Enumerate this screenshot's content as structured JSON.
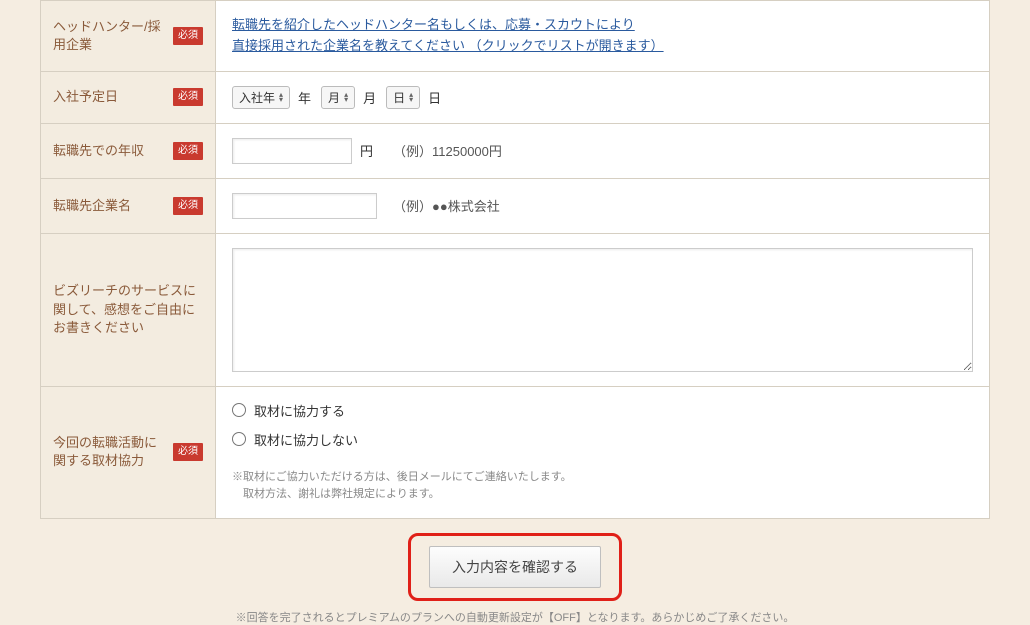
{
  "required_label": "必須",
  "rows": {
    "headhunter": {
      "label": "ヘッドハンター/採用企業",
      "required": true,
      "link_line1": "転職先を紹介したヘッドハンター名もしくは、応募・スカウトにより",
      "link_line2": "直接採用された企業名を教えてください （クリックでリストが開きます）"
    },
    "start_date": {
      "label": "入社予定日",
      "required": true,
      "year_select": "入社年",
      "month_select": "月",
      "day_select": "日",
      "year_unit": "年",
      "month_unit": "月",
      "day_unit": "日"
    },
    "salary": {
      "label": "転職先での年収",
      "required": true,
      "unit": "円",
      "example": "（例）11250000円"
    },
    "company": {
      "label": "転職先企業名",
      "required": true,
      "example": "（例）●●株式会社"
    },
    "feedback": {
      "label": "ビズリーチのサービスに関して、感想をご自由にお書きください",
      "required": false
    },
    "coverage": {
      "label": "今回の転職活動に関する取材協力",
      "required": true,
      "option_yes": "取材に協力する",
      "option_no": "取材に協力しない",
      "note1": "※取材にご協力いただける方は、後日メールにてご連絡いたします。",
      "note2": "　取材方法、謝礼は弊社規定によります。"
    }
  },
  "submit_label": "入力内容を確認する",
  "footer_note": "※回答を完了されるとプレミアムのプランへの自動更新設定が【OFF】となります。あらかじめご了承ください。"
}
